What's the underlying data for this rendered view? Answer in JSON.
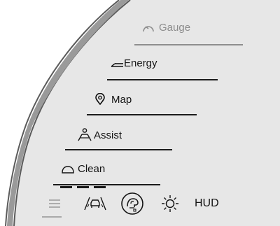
{
  "menu": {
    "items": [
      {
        "label": "Gauge",
        "icon": "gauge-icon",
        "state": "dimmed"
      },
      {
        "label": "Energy",
        "icon": "energy-icon",
        "state": "normal"
      },
      {
        "label": "Map",
        "icon": "map-pin-icon",
        "state": "normal"
      },
      {
        "label": "Assist",
        "icon": "assist-icon",
        "state": "normal"
      },
      {
        "label": "Clean",
        "icon": "clean-icon",
        "state": "normal"
      }
    ]
  },
  "bottom_bar": {
    "items": [
      {
        "name": "menu-lines-icon"
      },
      {
        "name": "car-lane-icon"
      },
      {
        "name": "driver-profile-icon"
      },
      {
        "name": "brightness-icon"
      },
      {
        "label": "HUD"
      }
    ]
  },
  "colors": {
    "background": "#e7e7e7",
    "text": "#141414",
    "dim_text": "#8c8c8c",
    "bezel": "#9a9a9a"
  }
}
